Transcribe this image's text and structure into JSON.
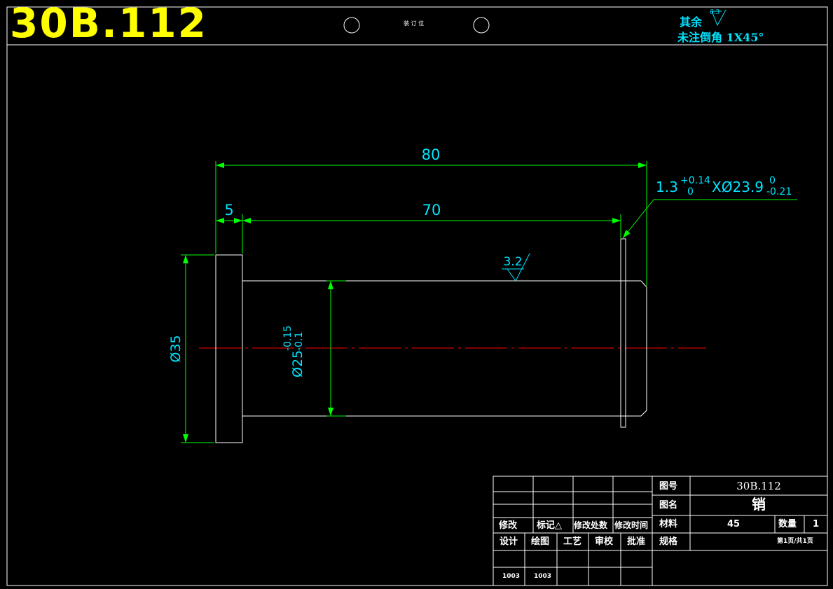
{
  "header": {
    "drawing_code": "30B.112",
    "binding_label": "装 订 位"
  },
  "notes": {
    "rest_label": "其余",
    "rest_roughness": "6.3",
    "chamfer_note": "未注倒角 1X45°"
  },
  "dimensions": {
    "overall_length": "80",
    "flange_width": "5",
    "shaft_length": "70",
    "flange_dia": "Ø35",
    "shaft_dia": "Ø25",
    "shaft_tol_upper": "-0.15",
    "shaft_tol_lower": "-0.1",
    "groove_base": "1.3",
    "groove_w_upper": "+0.14",
    "groove_w_lower": "0",
    "groove_dia": "XØ23.9",
    "groove_d_upper": "0",
    "groove_d_lower": "-0.21",
    "roughness_shaft": "3.2"
  },
  "colors": {
    "outline": "#ffffff",
    "dimension": "#00ff00",
    "centerline": "#ff0000",
    "text": "#00e5ff",
    "title": "#ffff00"
  },
  "title_block": {
    "rev_labels": [
      "修改",
      "标记△",
      "修改处数",
      "修改时间"
    ],
    "sign_labels": [
      "设计",
      "绘图",
      "工艺",
      "审校",
      "批准"
    ],
    "sign_dates": [
      "1003",
      "1003"
    ],
    "drawing_no_label": "图号",
    "drawing_no": "30B.112",
    "name_label": "图名",
    "name": "销",
    "material_label": "材料",
    "material": "45",
    "qty_label": "数量",
    "qty": "1",
    "spec_label": "规格",
    "sheet": "第1页/共1页"
  }
}
